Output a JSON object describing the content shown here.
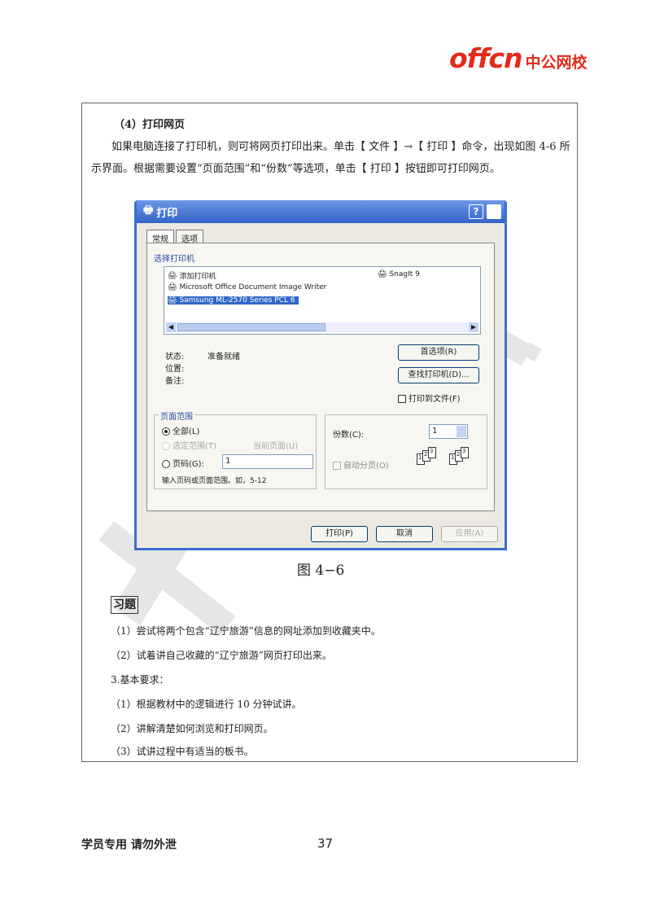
{
  "header": {
    "logo_brand": "offcn",
    "logo_name": "中公网校"
  },
  "section": {
    "heading": "（4）打印网页",
    "paragraph": "如果电脑连接了打印机，则可将网页打印出来。单击【 文件 】→【 打印 】命令，出现如图 4-6 所示界面。根据需要设置“页面范围”和“份数”等选项，单击【 打印 】按钮即可打印网页。"
  },
  "dialog": {
    "title": "打印",
    "help": "?",
    "tabs": [
      "常规",
      "选项"
    ],
    "group_printer": "选择打印机",
    "printers": [
      "添加打印机",
      "Microsoft Office Document Image Writer",
      "Samsung ML-2570 Series PCL 6",
      "SnagIt 9"
    ],
    "status_label": "状态:",
    "status_value": "准备就绪",
    "location_label": "位置:",
    "comment_label": "备注:",
    "prefs_button": "首选项(R)",
    "find_button": "查找打印机(D)...",
    "print_to_file": "打印到文件(F)",
    "range_label": "页面范围",
    "range_all": "全部(L)",
    "range_selection": "选定范围(T)",
    "range_current": "当前页面(U)",
    "range_pages": "页码(G):",
    "pages_value": "1",
    "pages_hint": "输入页码或页面范围。如，5-12",
    "copies_label": "份数(C):",
    "copies_value": "1",
    "collate": "自动分页(O)",
    "print_button": "打印(P)",
    "cancel_button": "取消",
    "apply_button": "应用(A)"
  },
  "figure_caption": "图 4−6",
  "exercises": {
    "title": "习题",
    "items": [
      "（1）尝试将两个包含“辽宁旅游”信息的网址添加到收藏夹中。",
      "（2）试着讲自己收藏的“辽宁旅游”网页打印出来。"
    ]
  },
  "requirements": {
    "title": "3.基本要求：",
    "items": [
      "（1）根据教材中的逻辑进行 10 分钟试讲。",
      "（2）讲解清楚如何浏览和打印网页。",
      "（3）试讲过程中有适当的板书。"
    ]
  },
  "footer": {
    "left": "学员专用  请勿外泄",
    "page": "37"
  }
}
